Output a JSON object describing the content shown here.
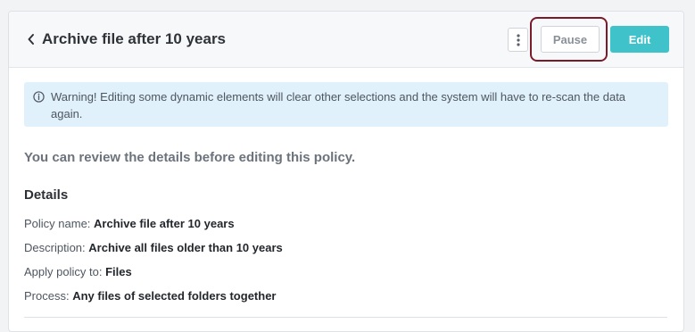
{
  "header": {
    "title": "Archive file after 10 years",
    "pause_label": "Pause",
    "edit_label": "Edit"
  },
  "warning": {
    "text": "Warning! Editing some dynamic elements will clear other selections and the system will have to re-scan the data again."
  },
  "intro": "You can review the details before editing this policy.",
  "details": {
    "heading": "Details",
    "rows": [
      {
        "label": "Policy name:",
        "value": "Archive file after 10 years"
      },
      {
        "label": "Description:",
        "value": "Archive all files older than 10 years"
      },
      {
        "label": "Apply policy to:",
        "value": "Files"
      },
      {
        "label": "Process:",
        "value": "Any files of selected folders together"
      }
    ]
  },
  "colors": {
    "accent": "#3fc2c9",
    "highlight": "#7a1b2b",
    "warning_bg": "#e0f1fb"
  },
  "icons": [
    "chevron-left-icon",
    "kebab-menu-icon",
    "info-icon"
  ]
}
